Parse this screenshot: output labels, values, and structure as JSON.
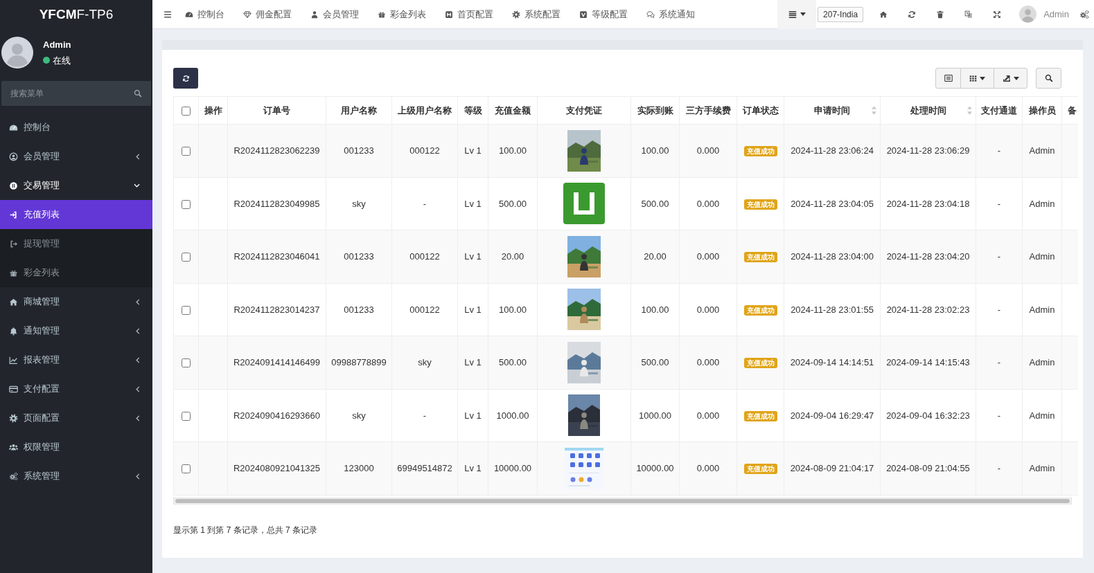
{
  "sidebar": {
    "logo": "**YFCM**F-TP6",
    "user": {
      "name": "Admin",
      "status": "在线",
      "online": true
    },
    "search": {
      "placeholder": "搜索菜单"
    },
    "items": [
      {
        "label": "控制台",
        "selected": false
      },
      {
        "label": "会员管理",
        "selected": false,
        "expanded": false
      },
      {
        "label": "交易管理",
        "selected": false,
        "expanded": true,
        "children": [
          {
            "label": "充值列表",
            "selected": true
          },
          {
            "label": "提现管理",
            "selected": false
          },
          {
            "label": "彩金列表",
            "selected": false
          }
        ]
      },
      {
        "label": "商城管理",
        "selected": false,
        "expanded": false
      },
      {
        "label": "通知管理",
        "selected": false,
        "expanded": false
      },
      {
        "label": "报表管理",
        "selected": false,
        "expanded": false
      },
      {
        "label": "支付配置",
        "selected": false,
        "expanded": false
      },
      {
        "label": "页面配置",
        "selected": false,
        "expanded": false
      },
      {
        "label": "权限管理",
        "selected": false
      },
      {
        "label": "系统管理",
        "selected": false,
        "expanded": false
      }
    ]
  },
  "topbar": {
    "nav": [
      "控制台",
      "佣金配置",
      "会员管理",
      "彩金列表",
      "首页配置",
      "系统配置",
      "等级配置",
      "系统通知"
    ],
    "site": "207-India",
    "user": "Admin"
  },
  "table": {
    "select_all": {
      "checked": false
    },
    "columns": [
      {
        "label": "操作",
        "sortable": false
      },
      {
        "label": "订单号",
        "sortable": false
      },
      {
        "label": "用户名称",
        "sortable": false
      },
      {
        "label": "上级用户名称",
        "sortable": false
      },
      {
        "label": "等级",
        "sortable": false
      },
      {
        "label": "充值金额",
        "sortable": false
      },
      {
        "label": "支付凭证",
        "sortable": false
      },
      {
        "label": "实际到账",
        "sortable": false
      },
      {
        "label": "三方手续费",
        "sortable": false
      },
      {
        "label": "订单状态",
        "sortable": false
      },
      {
        "label": "申请时间",
        "sortable": true
      },
      {
        "label": "处理时间",
        "sortable": true
      },
      {
        "label": "支付通道",
        "sortable": false
      },
      {
        "label": "操作员",
        "sortable": false
      },
      {
        "label": "备",
        "sortable": false
      }
    ],
    "rows": [
      {
        "checked": false,
        "order": "R2024112823062239",
        "user": "001233",
        "parent": "000122",
        "level": "Lv 1",
        "amount": "100.00",
        "actual": "100.00",
        "fee": "0.000",
        "status": "充值成功",
        "applied": "2024-11-28 23:06:24",
        "processed": "2024-11-28 23:06:29",
        "channel": "-",
        "operator": "Admin"
      },
      {
        "checked": false,
        "order": "R2024112823049985",
        "user": "sky",
        "parent": "-",
        "level": "Lv 1",
        "amount": "500.00",
        "actual": "500.00",
        "fee": "0.000",
        "status": "充值成功",
        "applied": "2024-11-28 23:04:05",
        "processed": "2024-11-28 23:04:18",
        "channel": "-",
        "operator": "Admin"
      },
      {
        "checked": false,
        "order": "R2024112823046041",
        "user": "001233",
        "parent": "000122",
        "level": "Lv 1",
        "amount": "20.00",
        "actual": "20.00",
        "fee": "0.000",
        "status": "充值成功",
        "applied": "2024-11-28 23:04:00",
        "processed": "2024-11-28 23:04:20",
        "channel": "-",
        "operator": "Admin"
      },
      {
        "checked": false,
        "order": "R2024112823014237",
        "user": "001233",
        "parent": "000122",
        "level": "Lv 1",
        "amount": "100.00",
        "actual": "100.00",
        "fee": "0.000",
        "status": "充值成功",
        "applied": "2024-11-28 23:01:55",
        "processed": "2024-11-28 23:02:23",
        "channel": "-",
        "operator": "Admin"
      },
      {
        "checked": false,
        "order": "R2024091414146499",
        "user": "09988778899",
        "parent": "sky",
        "level": "Lv 1",
        "amount": "500.00",
        "actual": "500.00",
        "fee": "0.000",
        "status": "充值成功",
        "applied": "2024-09-14 14:14:51",
        "processed": "2024-09-14 14:15:43",
        "channel": "-",
        "operator": "Admin"
      },
      {
        "checked": false,
        "order": "R2024090416293660",
        "user": "sky",
        "parent": "-",
        "level": "Lv 1",
        "amount": "1000.00",
        "actual": "1000.00",
        "fee": "0.000",
        "status": "充值成功",
        "applied": "2024-09-04 16:29:47",
        "processed": "2024-09-04 16:32:23",
        "channel": "-",
        "operator": "Admin"
      },
      {
        "checked": false,
        "order": "R2024080921041325",
        "user": "123000",
        "parent": "69949514872",
        "level": "Lv 1",
        "amount": "10000.00",
        "actual": "10000.00",
        "fee": "0.000",
        "status": "充值成功",
        "applied": "2024-08-09 21:04:17",
        "processed": "2024-08-09 21:04:55",
        "channel": "-",
        "operator": "Admin"
      }
    ]
  },
  "footer": "显示第 1 到第 7 条记录，总共 7 条记录"
}
